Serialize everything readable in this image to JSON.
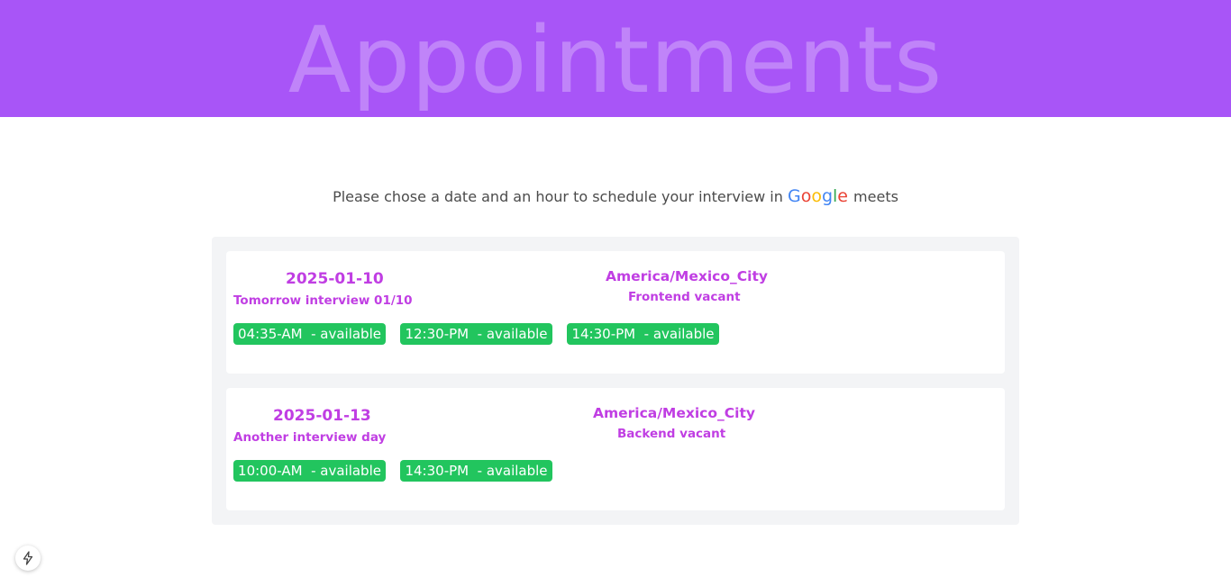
{
  "header": {
    "title": "Appointments"
  },
  "intro": {
    "text_before": "Please chose a date and an hour to schedule your interview in",
    "google_letters": [
      {
        "ch": "G",
        "color": "#4285f4"
      },
      {
        "ch": "o",
        "color": "#ea4335"
      },
      {
        "ch": "o",
        "color": "#fbbc05"
      },
      {
        "ch": "g",
        "color": "#4285f4"
      },
      {
        "ch": "l",
        "color": "#34a853"
      },
      {
        "ch": "e",
        "color": "#ea4335"
      }
    ],
    "text_after": "meets"
  },
  "appointments": [
    {
      "date": "2025-01-10",
      "description": "Tomorrow interview 01/10",
      "timezone": "America/Mexico_City",
      "vacant": "Frontend vacant",
      "slots": [
        "04:35-AM  - available",
        "12:30-PM  - available",
        "14:30-PM  - available"
      ]
    },
    {
      "date": "2025-01-13",
      "description": "Another interview day",
      "timezone": "America/Mexico_City",
      "vacant": "Backend vacant",
      "slots": [
        "10:00-AM  - available",
        "14:30-PM  - available"
      ]
    }
  ],
  "colors": {
    "header_bg": "#a855f7",
    "accent_text": "#c03ee3",
    "slot_bg": "#22c55e",
    "panel_bg": "#f3f4f6"
  },
  "dev_button": {
    "icon": "lightning-bolt-icon"
  }
}
